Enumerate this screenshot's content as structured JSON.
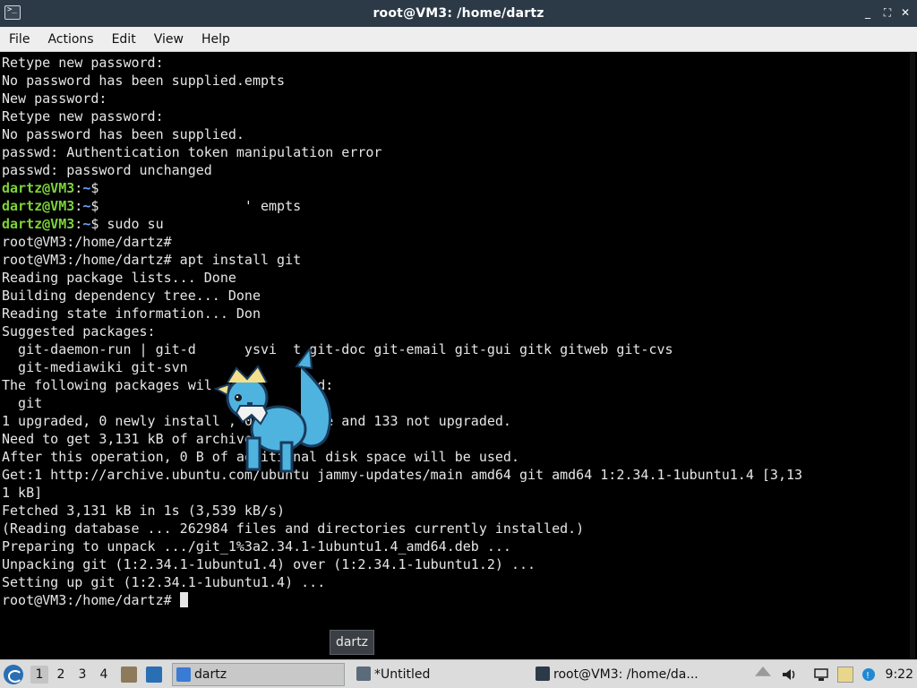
{
  "window": {
    "title": "root@VM3: /home/dartz",
    "controls": {
      "minimize": "_",
      "maximize": "⛶",
      "close": "✕"
    }
  },
  "menu": [
    "File",
    "Actions",
    "Edit",
    "View",
    "Help"
  ],
  "terminal": {
    "lines": [
      {
        "type": "text",
        "text": "Retype new password:"
      },
      {
        "type": "text",
        "text": "No password has been supplied.empts"
      },
      {
        "type": "text",
        "text": "New password:"
      },
      {
        "type": "text",
        "text": "Retype new password:"
      },
      {
        "type": "text",
        "text": "No password has been supplied."
      },
      {
        "type": "text",
        "text": "passwd: Authentication token manipulation error"
      },
      {
        "type": "text",
        "text": "passwd: password unchanged"
      },
      {
        "type": "prompt",
        "user": "dartz@VM3",
        "path": "~",
        "symbol": "$",
        "cmd": ""
      },
      {
        "type": "prompt",
        "user": "dartz@VM3",
        "path": "~",
        "symbol": "$",
        "cmd": "                  ' empts"
      },
      {
        "type": "prompt",
        "user": "dartz@VM3",
        "path": "~",
        "symbol": "$",
        "cmd": " sudo su"
      },
      {
        "type": "text",
        "text": "root@VM3:/home/dartz#"
      },
      {
        "type": "text",
        "text": "root@VM3:/home/dartz# apt install git"
      },
      {
        "type": "text",
        "text": "Reading package lists... Done"
      },
      {
        "type": "text",
        "text": "Building dependency tree... Done"
      },
      {
        "type": "text",
        "text": "Reading state information... Don"
      },
      {
        "type": "text",
        "text": "Suggested packages:"
      },
      {
        "type": "text",
        "text": "  git-daemon-run | git-d      ysvi  t git-doc git-email git-gui gitk gitweb git-cvs"
      },
      {
        "type": "text",
        "text": "  git-mediawiki git-svn"
      },
      {
        "type": "text",
        "text": "The following packages wil           ded:"
      },
      {
        "type": "text",
        "text": "  git"
      },
      {
        "type": "text",
        "text": "1 upgraded, 0 newly install , 0 to remove and 133 not upgraded."
      },
      {
        "type": "text",
        "text": "Need to get 3,131 kB of archives."
      },
      {
        "type": "text",
        "text": "After this operation, 0 B of additional disk space will be used."
      },
      {
        "type": "text",
        "text": "Get:1 http://archive.ubuntu.com/ubuntu jammy-updates/main amd64 git amd64 1:2.34.1-1ubuntu1.4 [3,13"
      },
      {
        "type": "text",
        "text": "1 kB]"
      },
      {
        "type": "text",
        "text": "Fetched 3,131 kB in 1s (3,539 kB/s)"
      },
      {
        "type": "text",
        "text": "(Reading database ... 262984 files and directories currently installed.)"
      },
      {
        "type": "text",
        "text": "Preparing to unpack .../git_1%3a2.34.1-1ubuntu1.4_amd64.deb ..."
      },
      {
        "type": "text",
        "text": "Unpacking git (1:2.34.1-1ubuntu1.4) over (1:2.34.1-1ubuntu1.2) ..."
      },
      {
        "type": "text",
        "text": "Setting up git (1:2.34.1-1ubuntu1.4) ..."
      },
      {
        "type": "cursor",
        "text": "root@VM3:/home/dartz# "
      }
    ]
  },
  "tooltip": "dartz",
  "taskbar": {
    "workspaces": [
      "1",
      "2",
      "3",
      "4"
    ],
    "active_workspace": "1",
    "tasks": [
      {
        "label": "dartz",
        "icon": "folder-icon",
        "color": "#3a7bd5"
      },
      {
        "label": "*Untitled",
        "icon": "text-editor-icon",
        "color": "#5b6b7a"
      },
      {
        "label": "root@VM3: /home/da...",
        "icon": "terminal-icon",
        "color": "#2c3a47"
      }
    ],
    "clock": "9:22"
  },
  "colors": {
    "prompt_user": "#7dd33a",
    "prompt_path": "#6aa4ff",
    "titlebar": "#2c3a47"
  }
}
